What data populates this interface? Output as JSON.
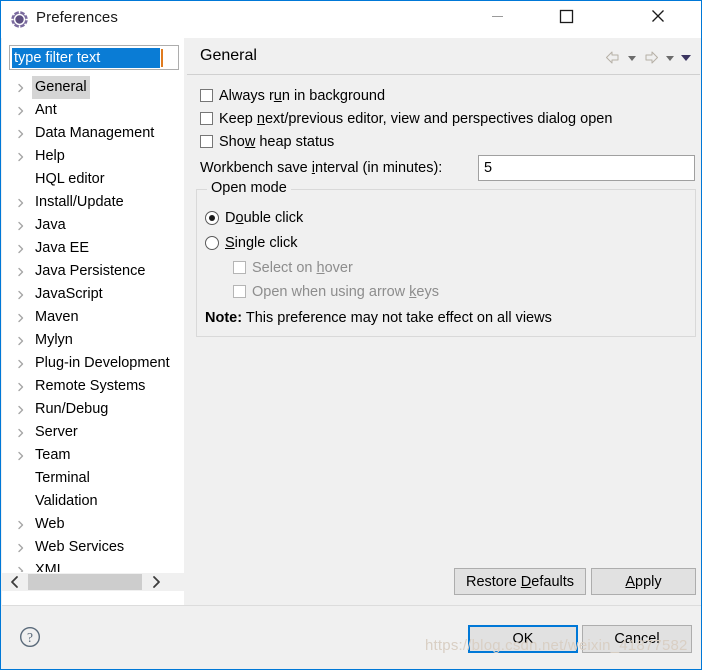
{
  "window": {
    "title": "Preferences",
    "icon": "preferences-gear-icon",
    "accent_color": "#0078d7",
    "controls": {
      "minimize": "minimize-icon",
      "maximize": "maximize-icon",
      "close": "close-icon"
    }
  },
  "sidebar": {
    "filter": {
      "value": "type filter text",
      "placeholder": "type filter text",
      "selected": true
    },
    "items": [
      {
        "label": "General",
        "expandable": true,
        "selected": true
      },
      {
        "label": "Ant",
        "expandable": true,
        "selected": false
      },
      {
        "label": "Data Management",
        "expandable": true,
        "selected": false
      },
      {
        "label": "Help",
        "expandable": true,
        "selected": false
      },
      {
        "label": "HQL editor",
        "expandable": false,
        "selected": false
      },
      {
        "label": "Install/Update",
        "expandable": true,
        "selected": false
      },
      {
        "label": "Java",
        "expandable": true,
        "selected": false
      },
      {
        "label": "Java EE",
        "expandable": true,
        "selected": false
      },
      {
        "label": "Java Persistence",
        "expandable": true,
        "selected": false
      },
      {
        "label": "JavaScript",
        "expandable": true,
        "selected": false
      },
      {
        "label": "Maven",
        "expandable": true,
        "selected": false
      },
      {
        "label": "Mylyn",
        "expandable": true,
        "selected": false
      },
      {
        "label": "Plug-in Development",
        "expandable": true,
        "selected": false
      },
      {
        "label": "Remote Systems",
        "expandable": true,
        "selected": false
      },
      {
        "label": "Run/Debug",
        "expandable": true,
        "selected": false
      },
      {
        "label": "Server",
        "expandable": true,
        "selected": false
      },
      {
        "label": "Team",
        "expandable": true,
        "selected": false
      },
      {
        "label": "Terminal",
        "expandable": false,
        "selected": false
      },
      {
        "label": "Validation",
        "expandable": false,
        "selected": false
      },
      {
        "label": "Web",
        "expandable": true,
        "selected": false
      },
      {
        "label": "Web Services",
        "expandable": true,
        "selected": false
      },
      {
        "label": "XML",
        "expandable": true,
        "selected": false
      }
    ],
    "scrollbar": {
      "left_arrow": "chevron-left-icon",
      "right_arrow": "chevron-right-icon"
    }
  },
  "page": {
    "title": "General",
    "nav": {
      "back": "back-arrow-icon",
      "back_dropdown": "chevron-down-icon",
      "forward": "forward-arrow-icon",
      "forward_dropdown": "chevron-down-icon",
      "menu_dropdown": "chevron-down-icon"
    },
    "checkboxes": [
      {
        "label": "Always run in background",
        "mnemonic": "u",
        "checked": false,
        "enabled": true
      },
      {
        "label": "Keep next/previous editor, view and perspectives dialog open",
        "mnemonic": "n",
        "checked": false,
        "enabled": true
      },
      {
        "label": "Show heap status",
        "mnemonic": "w",
        "checked": false,
        "enabled": true
      }
    ],
    "save_interval": {
      "label": "Workbench save interval (in minutes):",
      "mnemonic": "i",
      "value": "5"
    },
    "open_mode": {
      "legend": "Open mode",
      "radios": [
        {
          "label": "Double click",
          "mnemonic": "o",
          "selected": true
        },
        {
          "label": "Single click",
          "mnemonic": "S",
          "selected": false
        }
      ],
      "sub_checkboxes": [
        {
          "label": "Select on hover",
          "mnemonic": "h",
          "checked": false,
          "enabled": false
        },
        {
          "label": "Open when using arrow keys",
          "mnemonic": "k",
          "checked": false,
          "enabled": false
        }
      ],
      "note_prefix": "Note:",
      "note_text": "This preference may not take effect on all views"
    },
    "buttons": {
      "restore_defaults": "Restore Defaults",
      "restore_mnemonic": "D",
      "apply": "Apply",
      "apply_mnemonic": "A"
    }
  },
  "footer": {
    "help": "help-icon",
    "ok": "OK",
    "cancel": "Cancel",
    "default_button": "OK"
  },
  "watermark": "https://blog.csdn.net/weixin_41877582"
}
